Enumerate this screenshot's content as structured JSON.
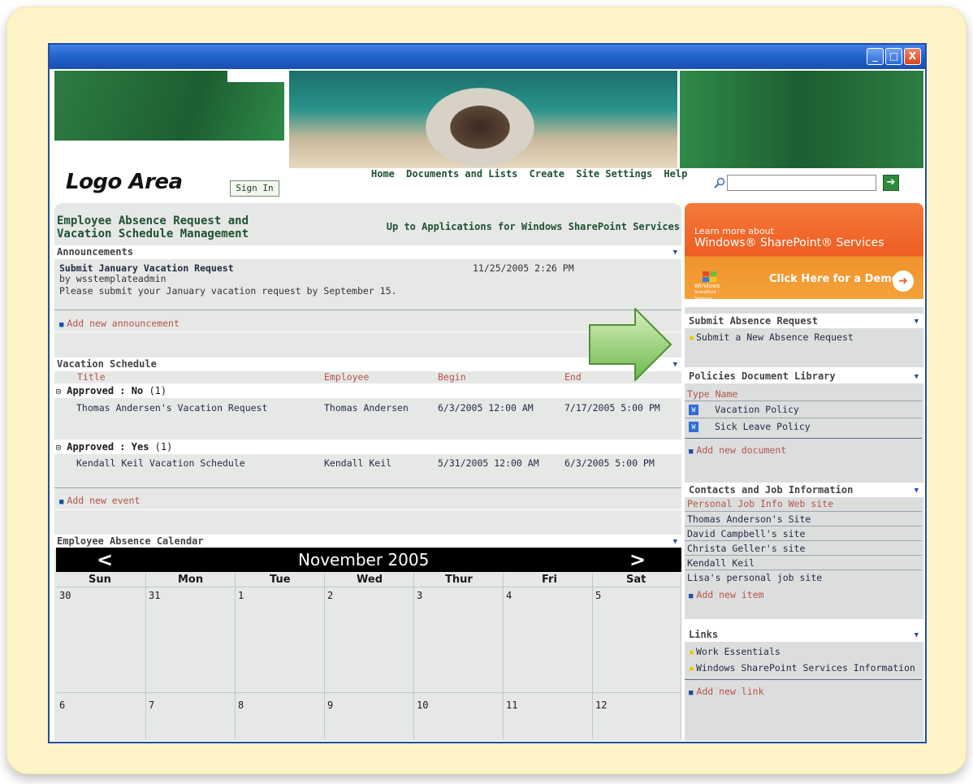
{
  "window": {
    "controls": [
      "_",
      "□",
      "X"
    ]
  },
  "header": {
    "logo": "Logo Area",
    "sign_in": "Sign In",
    "nav": [
      "Home",
      "Documents and Lists",
      "Create",
      "Site Settings",
      "Help"
    ]
  },
  "main": {
    "title_line1": "Employee Absence Request and",
    "title_line2": "Vacation Schedule Management",
    "up_link": "Up to Applications for Windows SharePoint Services",
    "announcements": {
      "heading": "Announcements",
      "item_title": "Submit January Vacation Request",
      "item_date": "11/25/2005 2:26 PM",
      "item_by": "by wsstemplateadmin",
      "item_body": "Please submit your January vacation request by September 15.",
      "add_link": "Add new announcement"
    },
    "vacation": {
      "heading": "Vacation Schedule",
      "columns": [
        "Title",
        "Employee",
        "Begin",
        "End"
      ],
      "groups": [
        {
          "label": "Approved : ",
          "value": "No",
          "count": "(1)",
          "row": [
            "Thomas Andersen's Vacation Request",
            "Thomas Andersen",
            "6/3/2005 12:00 AM",
            "7/17/2005 5:00 PM"
          ]
        },
        {
          "label": "Approved : ",
          "value": "Yes",
          "count": "(1)",
          "row": [
            "Kendall Keil Vacation Schedule",
            "Kendall Keil",
            "5/31/2005 12:00 AM",
            "6/3/2005 5:00 PM"
          ]
        }
      ],
      "add_link": "Add new event"
    },
    "calendar": {
      "heading": "Employee Absence Calendar",
      "prev": "<",
      "next": ">",
      "month": "November 2005",
      "days": [
        "Sun",
        "Mon",
        "Tue",
        "Wed",
        "Thur",
        "Fri",
        "Sat"
      ],
      "week1": [
        "30",
        "31",
        "1",
        "2",
        "3",
        "4",
        "5"
      ],
      "week2": [
        "6",
        "7",
        "8",
        "9",
        "10",
        "11",
        "12"
      ]
    }
  },
  "right": {
    "promo_l1": "Learn more about",
    "promo_l2": "Windows® SharePoint® Services",
    "promo_win": "Windows",
    "promo_sub": "SharePoint Services",
    "promo_demo": "Click Here for a Demo",
    "absence": {
      "heading": "Submit Absence Request",
      "item": "Submit a New Absence Request"
    },
    "policies": {
      "heading": "Policies Document Library",
      "col_header": "Type Name",
      "docs": [
        "Vacation Policy",
        "Sick Leave Policy"
      ],
      "add_link": "Add new document"
    },
    "contacts": {
      "heading": "Contacts and Job Information",
      "items": [
        "Personal Job Info Web site",
        "Thomas Anderson's Site",
        "David Campbell's site",
        "Christa Geller's site",
        "Kendall Keil",
        "Lisa's personal job site"
      ],
      "add_link": "Add new item"
    },
    "links": {
      "heading": "Links",
      "items": [
        "Work Essentials",
        "Windows SharePoint Services Information"
      ],
      "add_link": "Add new link"
    }
  },
  "colors": {
    "frame": "#fdf4c8",
    "titlebar": "#1f5fc9",
    "nav_green": "#1f5130",
    "link_red": "#b5534a",
    "promo_orange": "#ee5d22",
    "accent_arrow": "#7cc35a"
  }
}
